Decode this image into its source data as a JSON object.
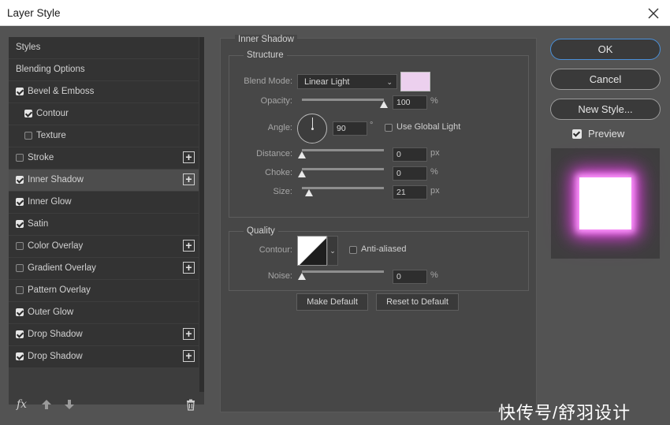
{
  "window": {
    "title": "Layer Style",
    "close_icon": "close-icon"
  },
  "styles_list": [
    {
      "label": "Styles",
      "checkbox": false,
      "checked": false,
      "indent": false,
      "plus": false,
      "selected": false
    },
    {
      "label": "Blending Options",
      "checkbox": false,
      "checked": false,
      "indent": false,
      "plus": false,
      "selected": false
    },
    {
      "label": "Bevel & Emboss",
      "checkbox": true,
      "checked": true,
      "indent": false,
      "plus": false,
      "selected": false
    },
    {
      "label": "Contour",
      "checkbox": true,
      "checked": true,
      "indent": true,
      "plus": false,
      "selected": false
    },
    {
      "label": "Texture",
      "checkbox": true,
      "checked": false,
      "indent": true,
      "plus": false,
      "selected": false
    },
    {
      "label": "Stroke",
      "checkbox": true,
      "checked": false,
      "indent": false,
      "plus": true,
      "selected": false
    },
    {
      "label": "Inner Shadow",
      "checkbox": true,
      "checked": true,
      "indent": false,
      "plus": true,
      "selected": true
    },
    {
      "label": "Inner Glow",
      "checkbox": true,
      "checked": true,
      "indent": false,
      "plus": false,
      "selected": false
    },
    {
      "label": "Satin",
      "checkbox": true,
      "checked": true,
      "indent": false,
      "plus": false,
      "selected": false
    },
    {
      "label": "Color Overlay",
      "checkbox": true,
      "checked": false,
      "indent": false,
      "plus": true,
      "selected": false
    },
    {
      "label": "Gradient Overlay",
      "checkbox": true,
      "checked": false,
      "indent": false,
      "plus": true,
      "selected": false
    },
    {
      "label": "Pattern Overlay",
      "checkbox": true,
      "checked": false,
      "indent": false,
      "plus": false,
      "selected": false
    },
    {
      "label": "Outer Glow",
      "checkbox": true,
      "checked": true,
      "indent": false,
      "plus": false,
      "selected": false
    },
    {
      "label": "Drop Shadow",
      "checkbox": true,
      "checked": true,
      "indent": false,
      "plus": true,
      "selected": false
    },
    {
      "label": "Drop Shadow",
      "checkbox": true,
      "checked": true,
      "indent": false,
      "plus": true,
      "selected": false
    }
  ],
  "bottom_toolbar": {
    "fx_label": "fx",
    "move_up_icon": "arrow-up-icon",
    "move_down_icon": "arrow-down-icon",
    "delete_icon": "trash-icon"
  },
  "inner_shadow": {
    "section_title": "Inner Shadow",
    "structure": {
      "group_title": "Structure",
      "blend_mode_label": "Blend Mode:",
      "blend_mode_value": "Linear Light",
      "swatch_color": "#ecd0ee",
      "opacity_label": "Opacity:",
      "opacity_value": "100",
      "opacity_unit": "%",
      "opacity_level": 1.0,
      "angle_label": "Angle:",
      "angle_value": "90",
      "angle_unit": "°",
      "use_global_light_label": "Use Global Light",
      "use_global_light_checked": false,
      "distance_label": "Distance:",
      "distance_value": "0",
      "distance_unit": "px",
      "distance_level": 0.0,
      "choke_label": "Choke:",
      "choke_value": "0",
      "choke_unit": "%",
      "choke_level": 0.0,
      "size_label": "Size:",
      "size_value": "21",
      "size_unit": "px",
      "size_level": 0.085
    },
    "quality": {
      "group_title": "Quality",
      "contour_label": "Contour:",
      "anti_aliased_label": "Anti-aliased",
      "anti_aliased_checked": false,
      "noise_label": "Noise:",
      "noise_value": "0",
      "noise_unit": "%",
      "noise_level": 0.0
    },
    "make_default_label": "Make Default",
    "reset_default_label": "Reset to Default"
  },
  "right_panel": {
    "ok_label": "OK",
    "cancel_label": "Cancel",
    "new_style_label": "New Style...",
    "preview_label": "Preview",
    "preview_checked": true
  },
  "watermark": "快传号/舒羽设计"
}
